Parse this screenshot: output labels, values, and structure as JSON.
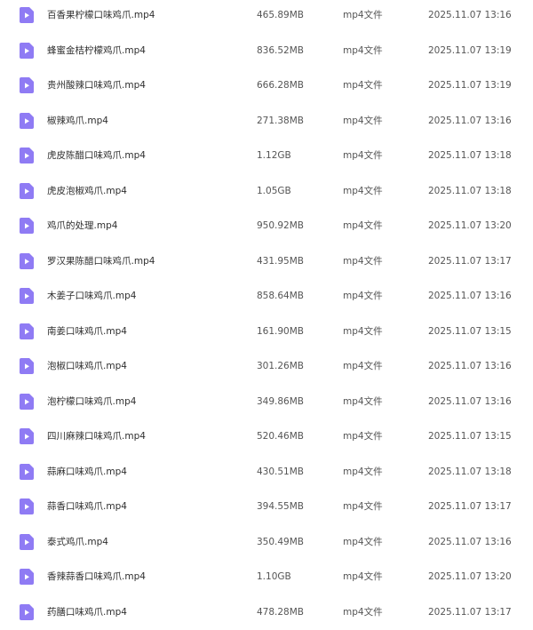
{
  "icon": {
    "name": "video-file-icon",
    "color": "#8f7bf4"
  },
  "files": [
    {
      "name": "百香果柠檬口味鸡爪.mp4",
      "size": "465.89MB",
      "type": "mp4文件",
      "modified": "2025.11.07 13:16"
    },
    {
      "name": "蜂蜜金桔柠檬鸡爪.mp4",
      "size": "836.52MB",
      "type": "mp4文件",
      "modified": "2025.11.07 13:19"
    },
    {
      "name": "贵州酸辣口味鸡爪.mp4",
      "size": "666.28MB",
      "type": "mp4文件",
      "modified": "2025.11.07 13:19"
    },
    {
      "name": "椒辣鸡爪.mp4",
      "size": "271.38MB",
      "type": "mp4文件",
      "modified": "2025.11.07 13:16"
    },
    {
      "name": "虎皮陈醋口味鸡爪.mp4",
      "size": "1.12GB",
      "type": "mp4文件",
      "modified": "2025.11.07 13:18"
    },
    {
      "name": "虎皮泡椒鸡爪.mp4",
      "size": "1.05GB",
      "type": "mp4文件",
      "modified": "2025.11.07 13:18"
    },
    {
      "name": "鸡爪的处理.mp4",
      "size": "950.92MB",
      "type": "mp4文件",
      "modified": "2025.11.07 13:20"
    },
    {
      "name": "罗汉果陈醋口味鸡爪.mp4",
      "size": "431.95MB",
      "type": "mp4文件",
      "modified": "2025.11.07 13:17"
    },
    {
      "name": "木姜子口味鸡爪.mp4",
      "size": "858.64MB",
      "type": "mp4文件",
      "modified": "2025.11.07 13:16"
    },
    {
      "name": "南姜口味鸡爪.mp4",
      "size": "161.90MB",
      "type": "mp4文件",
      "modified": "2025.11.07 13:15"
    },
    {
      "name": "泡椒口味鸡爪.mp4",
      "size": "301.26MB",
      "type": "mp4文件",
      "modified": "2025.11.07 13:16"
    },
    {
      "name": "泡柠檬口味鸡爪.mp4",
      "size": "349.86MB",
      "type": "mp4文件",
      "modified": "2025.11.07 13:16"
    },
    {
      "name": "四川麻辣口味鸡爪.mp4",
      "size": "520.46MB",
      "type": "mp4文件",
      "modified": "2025.11.07 13:15"
    },
    {
      "name": "蒜麻口味鸡爪.mp4",
      "size": "430.51MB",
      "type": "mp4文件",
      "modified": "2025.11.07 13:18"
    },
    {
      "name": "蒜香口味鸡爪.mp4",
      "size": "394.55MB",
      "type": "mp4文件",
      "modified": "2025.11.07 13:17"
    },
    {
      "name": "泰式鸡爪.mp4",
      "size": "350.49MB",
      "type": "mp4文件",
      "modified": "2025.11.07 13:16"
    },
    {
      "name": "香辣蒜香口味鸡爪.mp4",
      "size": "1.10GB",
      "type": "mp4文件",
      "modified": "2025.11.07 13:20"
    },
    {
      "name": "药膳口味鸡爪.mp4",
      "size": "478.28MB",
      "type": "mp4文件",
      "modified": "2025.11.07 13:17"
    }
  ]
}
